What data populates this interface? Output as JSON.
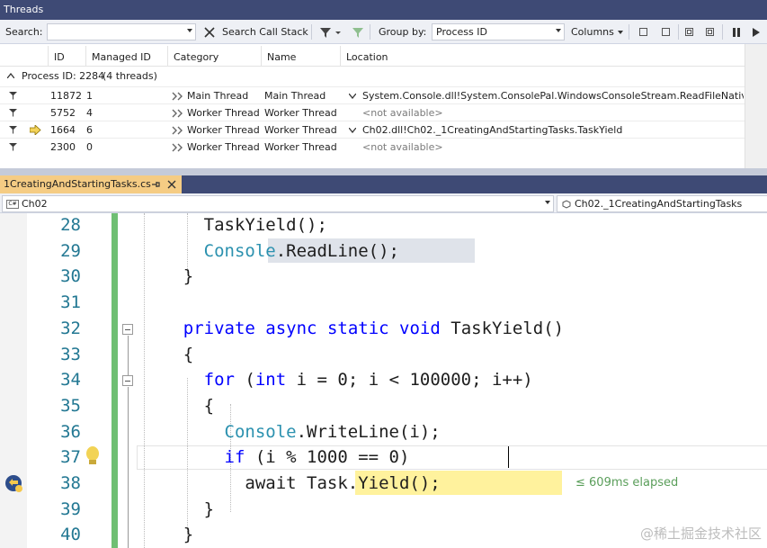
{
  "window": {
    "title": "Threads"
  },
  "toolbar": {
    "search_label": "Search:",
    "search_value": "",
    "search_call_stack": "Search Call Stack",
    "group_by_label": "Group by:",
    "group_by_value": "Process ID",
    "columns_label": "Columns"
  },
  "grid": {
    "headers": [
      "ID",
      "Managed ID",
      "Category",
      "Name",
      "Location"
    ],
    "process_label": "Process ID: 2284",
    "process_threads": "(4 threads)",
    "rows": [
      {
        "id": "11872",
        "managed_id": "1",
        "category": "Main Thread",
        "name": "Main Thread",
        "location": "System.Console.dll!System.ConsolePal.WindowsConsoleStream.ReadFileNative",
        "current": false,
        "has_expander": true,
        "location_dim": false
      },
      {
        "id": "5752",
        "managed_id": "4",
        "category": "Worker Thread",
        "name": "Worker Thread",
        "location": "<not available>",
        "current": false,
        "has_expander": false,
        "location_dim": true
      },
      {
        "id": "1664",
        "managed_id": "6",
        "category": "Worker Thread",
        "name": "Worker Thread",
        "location": "Ch02.dll!Ch02._1CreatingAndStartingTasks.TaskYield",
        "current": true,
        "has_expander": true,
        "location_dim": false
      },
      {
        "id": "2300",
        "managed_id": "0",
        "category": "Worker Thread",
        "name": "Worker Thread",
        "location": "<not available>",
        "current": false,
        "has_expander": false,
        "location_dim": true
      }
    ]
  },
  "editor": {
    "tab_title": "1CreatingAndStartingTasks.cs",
    "project": "Ch02",
    "type_nav": "Ch02._1CreatingAndStartingTasks",
    "elapsed": "≤ 609ms elapsed",
    "lines": [
      {
        "n": "28",
        "html": "      TaskYield();"
      },
      {
        "n": "29",
        "html": "      <span class='ty'>Console</span>.ReadLine();"
      },
      {
        "n": "30",
        "html": "    }"
      },
      {
        "n": "31",
        "html": ""
      },
      {
        "n": "32",
        "html": "    <span class='kw'>private</span> <span class='kw'>async</span> <span class='kw'>static</span> <span class='kw'>void</span> TaskYield()"
      },
      {
        "n": "33",
        "html": "    {"
      },
      {
        "n": "34",
        "html": "      <span class='kw'>for</span> (<span class='kw'>int</span> i = 0; i &lt; 100000; i++)"
      },
      {
        "n": "35",
        "html": "      {"
      },
      {
        "n": "36",
        "html": "        <span class='ty'>Console</span>.WriteLine(i);"
      },
      {
        "n": "37",
        "html": "        <span class='kw'>if</span> (i % 1000 == 0)"
      },
      {
        "n": "38",
        "html": "          await Task.Yield();"
      },
      {
        "n": "39",
        "html": "      }"
      },
      {
        "n": "40",
        "html": "    }"
      }
    ]
  },
  "watermark": "@稀土掘金技术社区",
  "colors": {
    "accent": "#3e4a75",
    "tab": "#f5cc84",
    "current_stmt": "#fff29d",
    "green_margin": "#6fbf73",
    "keyword": "#0000ff",
    "type": "#2b91af",
    "line_number": "#237893"
  }
}
